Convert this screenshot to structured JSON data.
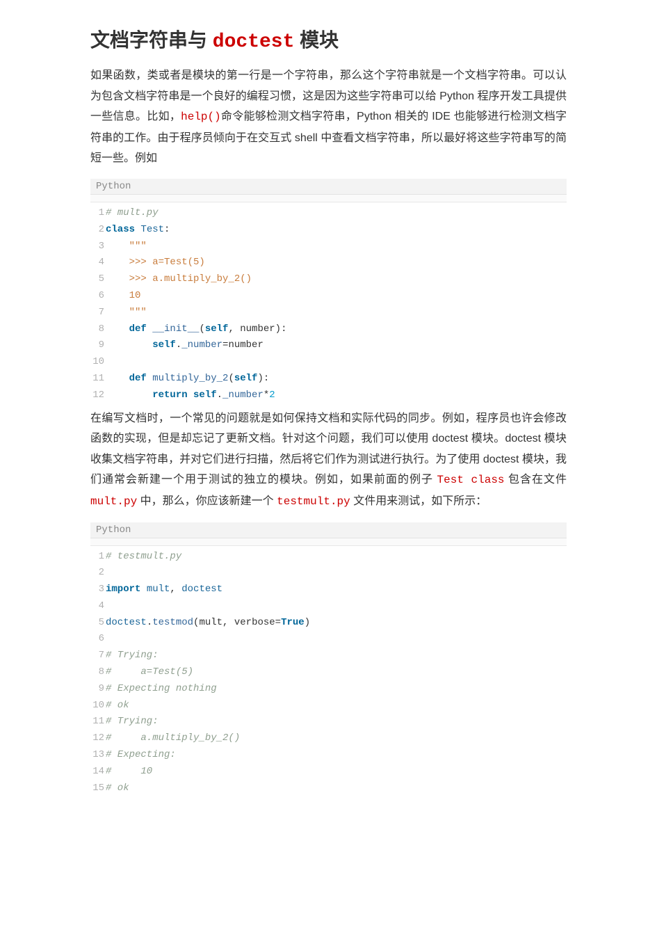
{
  "heading": {
    "pre": "文档字符串与 ",
    "code": "doctest",
    "post": " 模块"
  },
  "intro": {
    "p1a": "如果函数，类或者是模块的第一行是一个字符串，那么这个字符串就是一个文档字符串。可以认为包含文档字符串是一个良好的编程习惯，这是因为这些字符串可以给 Python 程序开发工具提供一些信息。比如，",
    "help_code": "help()",
    "p1b": "命令能够检测文档字符串，Python 相关的 IDE 也能够进行检测文档字符串的工作。由于程序员倾向于在交互式 shell 中查看文档字符串，所以最好将这些字符串写的简短一些。例如"
  },
  "codeblocks": {
    "label": "Python",
    "block1": {
      "lines": [
        {
          "n": "1",
          "tokens": [
            {
              "t": "# mult.py",
              "c": "tok-comment"
            }
          ]
        },
        {
          "n": "2",
          "tokens": [
            {
              "t": "class ",
              "c": "tok-keyword"
            },
            {
              "t": "Test",
              "c": "tok-classname"
            },
            {
              "t": ":",
              "c": "tok-op"
            }
          ]
        },
        {
          "n": "3",
          "tokens": [
            {
              "t": "    ",
              "c": "tok-plain"
            },
            {
              "t": "\"\"\"",
              "c": "tok-docstring"
            }
          ]
        },
        {
          "n": "4",
          "tokens": [
            {
              "t": "    ",
              "c": "tok-plain"
            },
            {
              "t": ">>> a=Test(5)",
              "c": "tok-docstring"
            }
          ]
        },
        {
          "n": "5",
          "tokens": [
            {
              "t": "    ",
              "c": "tok-plain"
            },
            {
              "t": ">>> a.multiply_by_2()",
              "c": "tok-docstring"
            }
          ]
        },
        {
          "n": "6",
          "tokens": [
            {
              "t": "    ",
              "c": "tok-plain"
            },
            {
              "t": "10",
              "c": "tok-docstring"
            }
          ]
        },
        {
          "n": "7",
          "tokens": [
            {
              "t": "    ",
              "c": "tok-plain"
            },
            {
              "t": "\"\"\"",
              "c": "tok-docstring"
            }
          ]
        },
        {
          "n": "8",
          "tokens": [
            {
              "t": "    ",
              "c": "tok-plain"
            },
            {
              "t": "def ",
              "c": "tok-keyword"
            },
            {
              "t": "__init__",
              "c": "tok-func"
            },
            {
              "t": "(",
              "c": "tok-op"
            },
            {
              "t": "self",
              "c": "tok-self"
            },
            {
              "t": ", number):",
              "c": "tok-op"
            }
          ]
        },
        {
          "n": "9",
          "tokens": [
            {
              "t": "        ",
              "c": "tok-plain"
            },
            {
              "t": "self",
              "c": "tok-self"
            },
            {
              "t": ".",
              "c": "tok-op"
            },
            {
              "t": "_number",
              "c": "tok-attr"
            },
            {
              "t": "=",
              "c": "tok-op"
            },
            {
              "t": "number",
              "c": "tok-plain"
            }
          ]
        },
        {
          "n": "10",
          "tokens": [
            {
              "t": "",
              "c": "tok-plain"
            }
          ]
        },
        {
          "n": "11",
          "tokens": [
            {
              "t": "    ",
              "c": "tok-plain"
            },
            {
              "t": "def ",
              "c": "tok-keyword"
            },
            {
              "t": "multiply_by_2",
              "c": "tok-func"
            },
            {
              "t": "(",
              "c": "tok-op"
            },
            {
              "t": "self",
              "c": "tok-self"
            },
            {
              "t": "):",
              "c": "tok-op"
            }
          ]
        },
        {
          "n": "12",
          "tokens": [
            {
              "t": "        ",
              "c": "tok-plain"
            },
            {
              "t": "return ",
              "c": "tok-keyword"
            },
            {
              "t": "self",
              "c": "tok-self"
            },
            {
              "t": ".",
              "c": "tok-op"
            },
            {
              "t": "_number",
              "c": "tok-attr"
            },
            {
              "t": "*",
              "c": "tok-op"
            },
            {
              "t": "2",
              "c": "tok-number"
            }
          ]
        }
      ]
    },
    "block2": {
      "lines": [
        {
          "n": "1",
          "tokens": [
            {
              "t": "# testmult.py",
              "c": "tok-comment"
            }
          ]
        },
        {
          "n": "2",
          "tokens": [
            {
              "t": "",
              "c": "tok-plain"
            }
          ]
        },
        {
          "n": "3",
          "tokens": [
            {
              "t": "import ",
              "c": "tok-keyword"
            },
            {
              "t": "mult",
              "c": "tok-classname"
            },
            {
              "t": ", ",
              "c": "tok-op"
            },
            {
              "t": "doctest",
              "c": "tok-classname"
            }
          ]
        },
        {
          "n": "4",
          "tokens": [
            {
              "t": "",
              "c": "tok-plain"
            }
          ]
        },
        {
          "n": "5",
          "tokens": [
            {
              "t": "doctest",
              "c": "tok-classname"
            },
            {
              "t": ".",
              "c": "tok-op"
            },
            {
              "t": "testmod",
              "c": "tok-func"
            },
            {
              "t": "(",
              "c": "tok-op"
            },
            {
              "t": "mult",
              "c": "tok-plain"
            },
            {
              "t": ", ",
              "c": "tok-op"
            },
            {
              "t": "verbose",
              "c": "tok-plain"
            },
            {
              "t": "=",
              "c": "tok-op"
            },
            {
              "t": "True",
              "c": "tok-bool"
            },
            {
              "t": ")",
              "c": "tok-op"
            }
          ]
        },
        {
          "n": "6",
          "tokens": [
            {
              "t": "",
              "c": "tok-plain"
            }
          ]
        },
        {
          "n": "7",
          "tokens": [
            {
              "t": "# Trying:",
              "c": "tok-comment"
            }
          ]
        },
        {
          "n": "8",
          "tokens": [
            {
              "t": "#     a=Test(5)",
              "c": "tok-comment"
            }
          ]
        },
        {
          "n": "9",
          "tokens": [
            {
              "t": "# Expecting nothing",
              "c": "tok-comment"
            }
          ]
        },
        {
          "n": "10",
          "tokens": [
            {
              "t": "# ok",
              "c": "tok-comment"
            }
          ]
        },
        {
          "n": "11",
          "tokens": [
            {
              "t": "# Trying:",
              "c": "tok-comment"
            }
          ]
        },
        {
          "n": "12",
          "tokens": [
            {
              "t": "#     a.multiply_by_2()",
              "c": "tok-comment"
            }
          ]
        },
        {
          "n": "13",
          "tokens": [
            {
              "t": "# Expecting:",
              "c": "tok-comment"
            }
          ]
        },
        {
          "n": "14",
          "tokens": [
            {
              "t": "#     10",
              "c": "tok-comment"
            }
          ]
        },
        {
          "n": "15",
          "tokens": [
            {
              "t": "# ok",
              "c": "tok-comment"
            }
          ]
        }
      ]
    }
  },
  "mid": {
    "p2a": "在编写文档时，一个常见的问题就是如何保持文档和实际代码的同步。例如，程序员也许会修改函数的实现，但是却忘记了更新文档。针对这个问题，我们可以使用 doctest 模块。doctest 模块收集文档字符串，并对它们进行扫描，然后将它们作为测试进行执行。为了使用 doctest 模块，我们通常会新建一个用于测试的独立的模块。例如，如果前面的例子 ",
    "test_class": "Test class",
    "p2b": " 包含在文件 ",
    "mult_py": "mult.py",
    "p2c": " 中，那么，你应该新建一个 ",
    "testmult_py": "testmult.py",
    "p2d": " 文件用来测试，如下所示："
  }
}
